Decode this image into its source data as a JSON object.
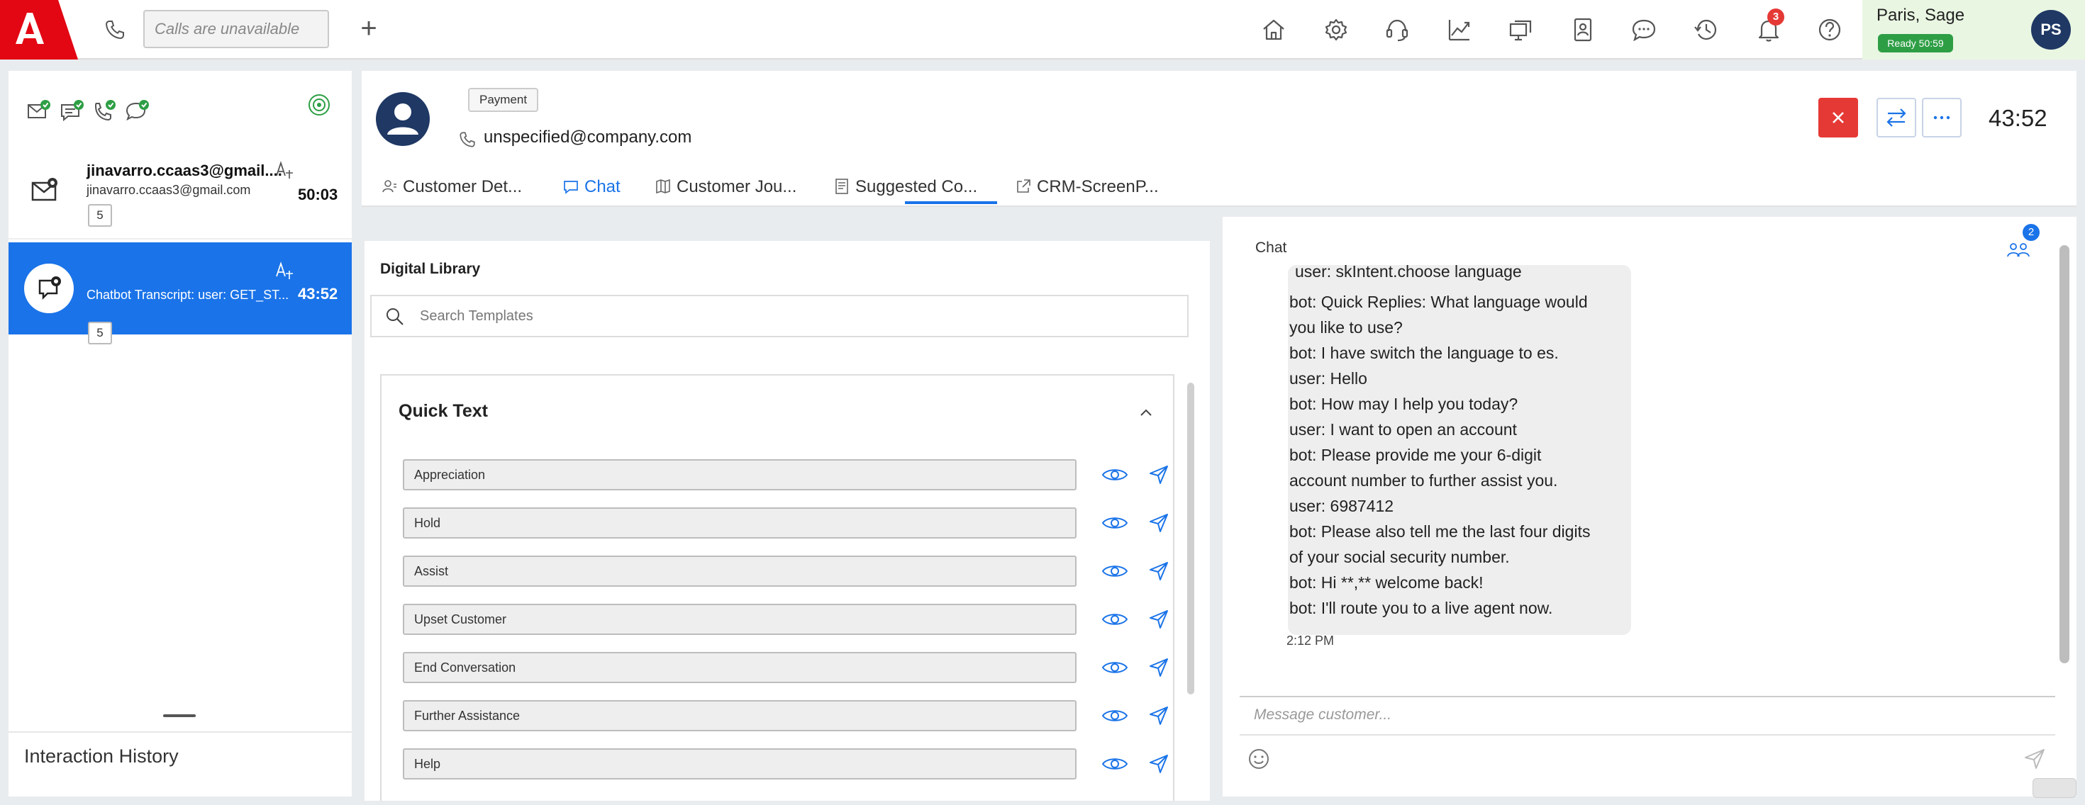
{
  "topbar": {
    "calls_placeholder": "Calls are unavailable",
    "plus_label": "+",
    "notification_count": "3",
    "user": {
      "name": "Paris, Sage",
      "status": "Ready 50:59",
      "initials": "PS"
    },
    "nav_icons": [
      "home-icon",
      "settings-icon",
      "headset-icon",
      "analytics-icon",
      "screens-icon",
      "contacts-icon",
      "chat-bubble-icon",
      "history-icon",
      "bell-icon",
      "help-icon"
    ]
  },
  "sidebar": {
    "channel_icons": [
      "email-check-icon",
      "chat-check-icon",
      "phone-check-icon",
      "message-check-icon"
    ],
    "interactions": [
      {
        "title": "jinavarro.ccaas3@gmail....",
        "subtitle": "jinavarro.ccaas3@gmail.com",
        "time": "50:03",
        "count": "5",
        "icon": "email-icon"
      },
      {
        "title": "Chatbot Transcript: user: GET_ST...",
        "time": "43:52",
        "count": "5",
        "icon": "chat-icon"
      }
    ],
    "history_label": "Interaction History"
  },
  "header": {
    "tag": "Payment",
    "email": "unspecified@company.com",
    "timer": "43:52",
    "tabs": [
      {
        "label": "Customer Det...",
        "icon": "person-icon"
      },
      {
        "label": "Chat",
        "icon": "chat-icon"
      },
      {
        "label": "Customer Jou...",
        "icon": "journey-icon"
      },
      {
        "label": "Suggested Co...",
        "icon": "document-icon"
      },
      {
        "label": "CRM-ScreenP...",
        "icon": "external-link-icon"
      }
    ]
  },
  "library": {
    "title": "Digital Library",
    "search_placeholder": "Search Templates",
    "quick_text_title": "Quick Text",
    "items": [
      "Appreciation",
      "Hold",
      "Assist",
      "Upset Customer",
      "End Conversation",
      "Further Assistance",
      "Help"
    ]
  },
  "chat": {
    "title": "Chat",
    "participants_count": "2",
    "top_cut_line": "user: skIntent.choose language",
    "lines": [
      "bot: Quick Replies: What language would",
      "you like to use?",
      "bot: I have switch the language to es.",
      "user: Hello",
      "bot: How may I help you today?",
      "user: I want to open an account",
      "bot: Please provide me your 6-digit",
      "account number to further assist you.",
      "user: 6987412",
      "bot: Please also tell me the last four digits",
      "of your social security number.",
      "bot: Hi **,** welcome back!",
      "bot: I'll route you to a live agent now."
    ],
    "timestamp": "2:12 PM",
    "input_placeholder": "Message customer..."
  },
  "colors": {
    "brand_red": "#e30613",
    "accent_blue": "#1a73e8",
    "status_green": "#2e9e45",
    "close_red": "#e53935",
    "avatar_navy": "#1f3864"
  }
}
